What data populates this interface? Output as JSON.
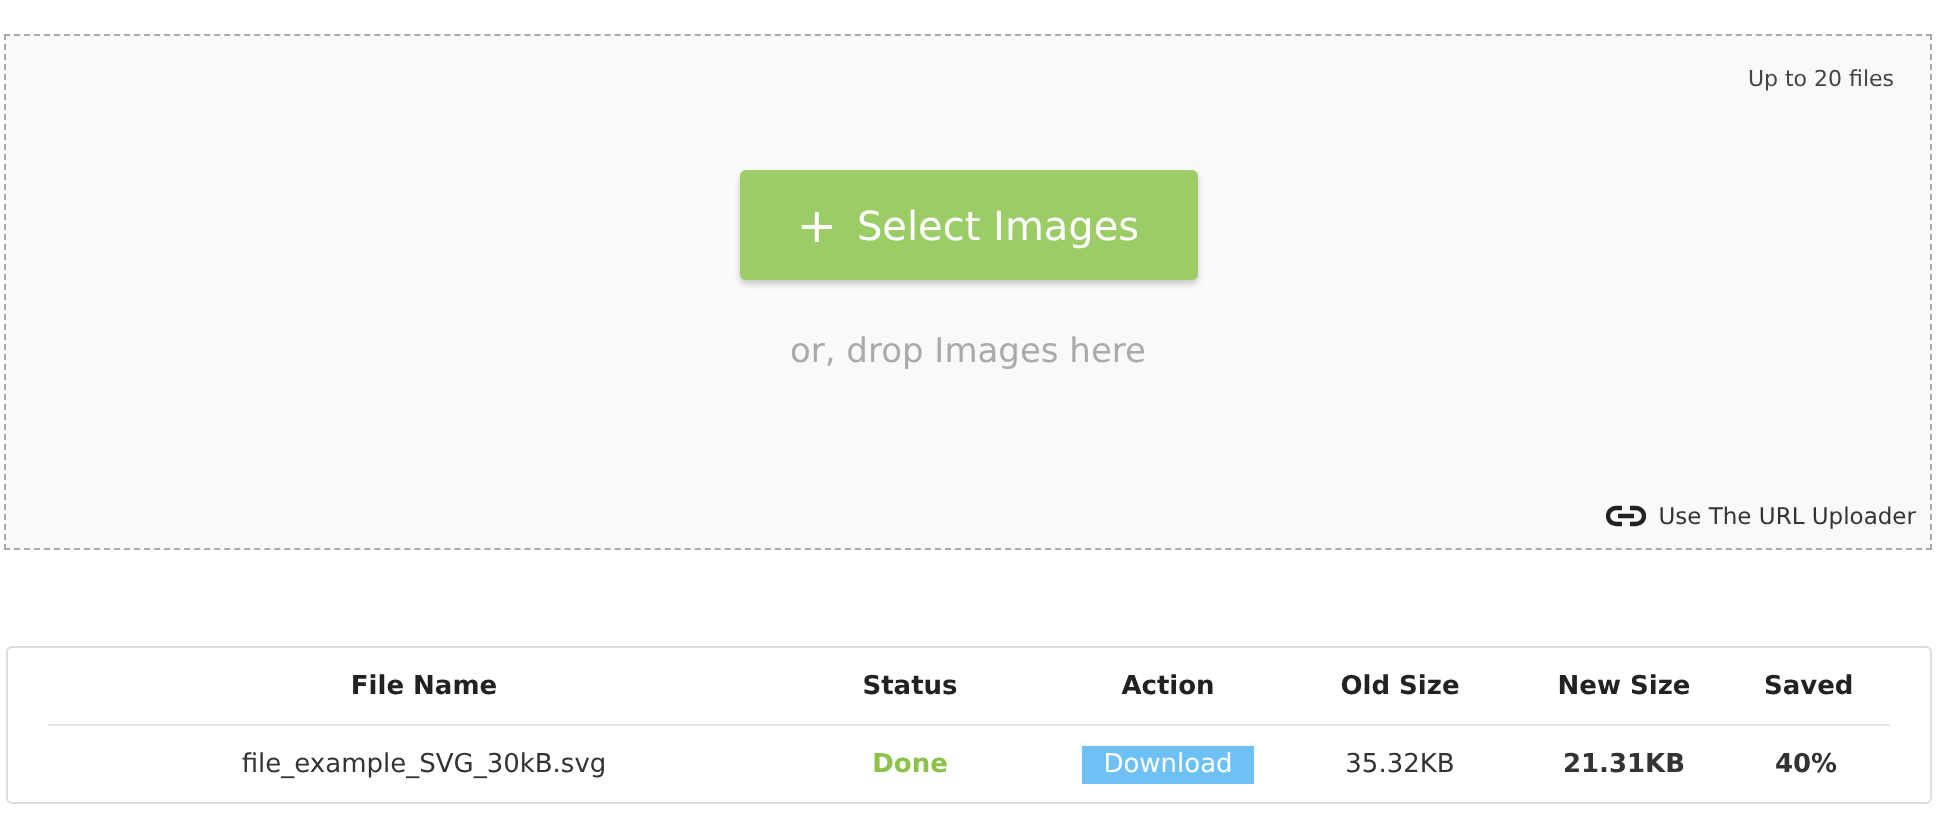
{
  "dropzone": {
    "limit": "Up to 20 files",
    "button": {
      "icon": "+",
      "label": "Select Images"
    },
    "hint": "or, drop Images here",
    "url_uploader": "Use The URL Uploader"
  },
  "table": {
    "columns": [
      "File Name",
      "Status",
      "Action",
      "Old Size",
      "New Size",
      "Saved"
    ],
    "rows": [
      {
        "file_name": "file_example_SVG_30kB.svg",
        "status": "Done",
        "action": "Download",
        "old_size": "35.32KB",
        "new_size": "21.31KB",
        "saved": "40%"
      }
    ]
  }
}
